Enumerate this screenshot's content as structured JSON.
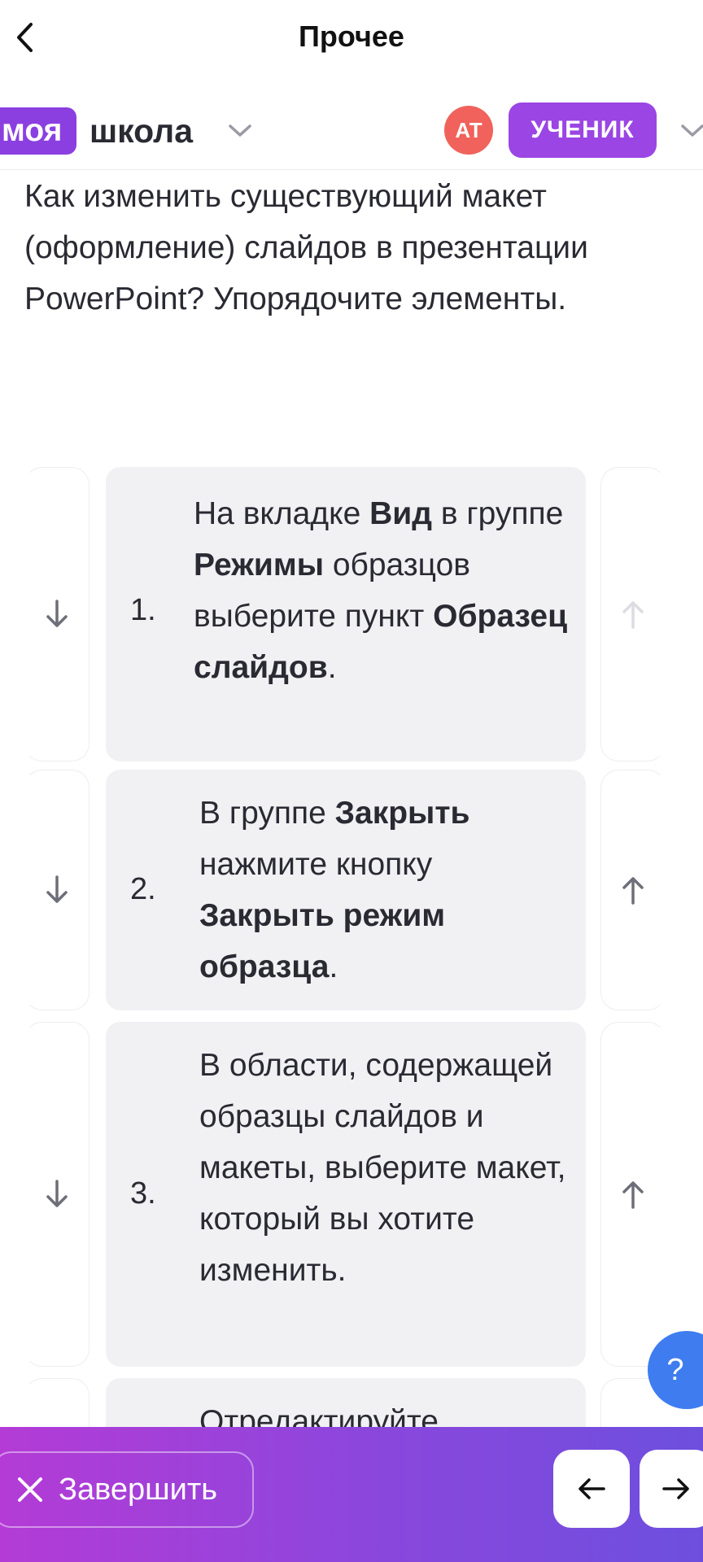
{
  "topbar": {
    "title": "Прочее"
  },
  "header": {
    "logo_part1": "моя",
    "logo_part2": "школа",
    "avatar_initials": "АТ",
    "role": "УЧЕНИК"
  },
  "question": "Как изменить существующий макет (оформление) слайдов в презентации PowerPoint? Упорядочите элементы.",
  "items": [
    {
      "number": "1.",
      "text_parts": [
        "На вкладке ",
        "Вид",
        " в группе ",
        "Режимы",
        " образцов выберите пункт ",
        "Образец слайдов",
        "."
      ]
    },
    {
      "number": "2.",
      "text_parts": [
        "В группе ",
        "Закрыть",
        " нажмите кнопку ",
        "Закрыть режим образца",
        "."
      ]
    },
    {
      "number": "3.",
      "text_parts": [
        "В области, содержащей образцы слайдов и макеты, выберите макет, который вы хотите изменить."
      ]
    },
    {
      "number": "",
      "text_parts": [
        "Отредактируйте"
      ]
    }
  ],
  "bottom": {
    "finish_label": "Завершить"
  },
  "help_label": "?"
}
